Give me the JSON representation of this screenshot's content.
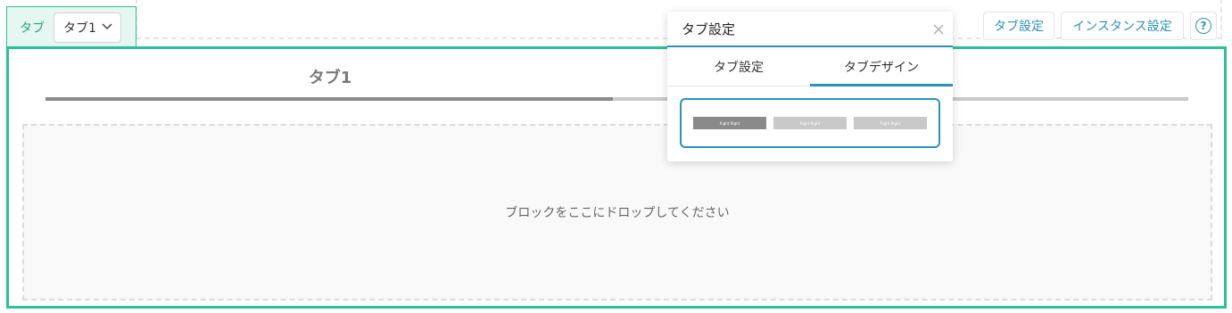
{
  "header": {
    "tab_label": "タブ",
    "selected_tab": "タブ1",
    "buttons": {
      "tab_settings": "タブ設定",
      "instance_settings": "インスタンス設定",
      "help": "?"
    }
  },
  "main": {
    "tab_title": "タブ1",
    "drop_placeholder": "ブロックをここにドロップしてください"
  },
  "popup": {
    "title": "タブ設定",
    "tabs": [
      {
        "label": "タブ設定",
        "active": false
      },
      {
        "label": "タブデザイン",
        "active": true
      }
    ],
    "design_preview_tabs": [
      "Right Right",
      "Right Right",
      "Right Right"
    ]
  },
  "colors": {
    "accent_green": "#27c19a",
    "accent_blue": "#2a93b8",
    "tab_active": "#8a8a8a",
    "tab_inactive": "#c9c9c9"
  }
}
